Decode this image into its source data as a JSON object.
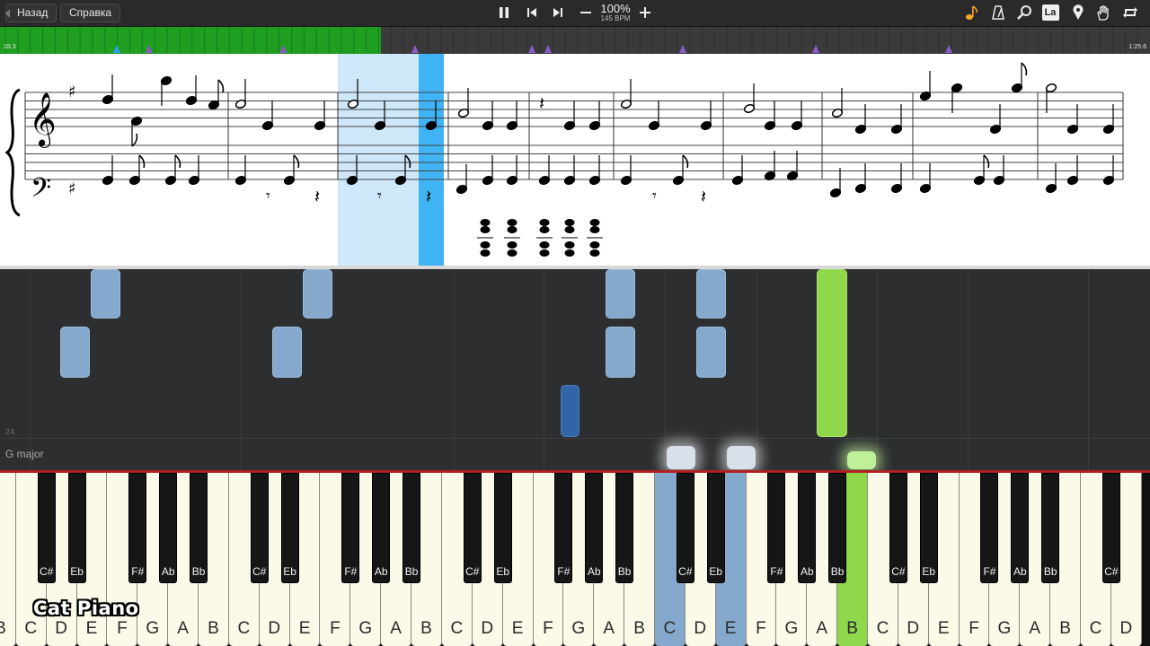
{
  "toolbar": {
    "back_label": "Назад",
    "help_label": "Справка",
    "tempo_percent": "100%",
    "tempo_bpm": "145 BPM",
    "icons": [
      "pause-icon",
      "previous-icon",
      "next-icon",
      "minus-icon",
      "plus-icon",
      "note-icon",
      "metronome-icon",
      "magnifier-icon",
      "la-icon",
      "location-pin-icon",
      "hand-icon",
      "loop-icon"
    ],
    "la_label": "La",
    "accent_color": "#f5a623"
  },
  "timeline": {
    "start_time": "28.3",
    "end_time": "1:25.6",
    "progress": 0.331,
    "progress_color": "#1f9e1f"
  },
  "waterfall": {
    "measure_number": "24",
    "key_signature": "G major"
  },
  "keyboard": {
    "white_keys": [
      "B",
      "C",
      "D",
      "E",
      "F",
      "G",
      "A",
      "B",
      "C",
      "D",
      "E",
      "F",
      "G",
      "A",
      "B",
      "C",
      "D",
      "E",
      "F",
      "G",
      "A",
      "B",
      "C",
      "D",
      "E",
      "F",
      "G",
      "A",
      "B",
      "C",
      "D",
      "E",
      "F",
      "G",
      "A",
      "B",
      "C",
      "D"
    ],
    "black_keys": [
      "Bb",
      "C#",
      "Eb",
      "F#",
      "Ab",
      "Bb",
      "C#",
      "Eb",
      "F#",
      "Ab",
      "Bb",
      "C#",
      "Eb",
      "F#",
      "Ab",
      "Bb",
      "C#",
      "Eb",
      "F#",
      "Ab",
      "Bb",
      "C#",
      "Eb",
      "F#",
      "Ab",
      "Bb",
      "C#"
    ],
    "highlight_blue": [
      "C",
      "E"
    ],
    "highlight_green": [
      "B"
    ]
  },
  "watermark": "Cat Piano"
}
